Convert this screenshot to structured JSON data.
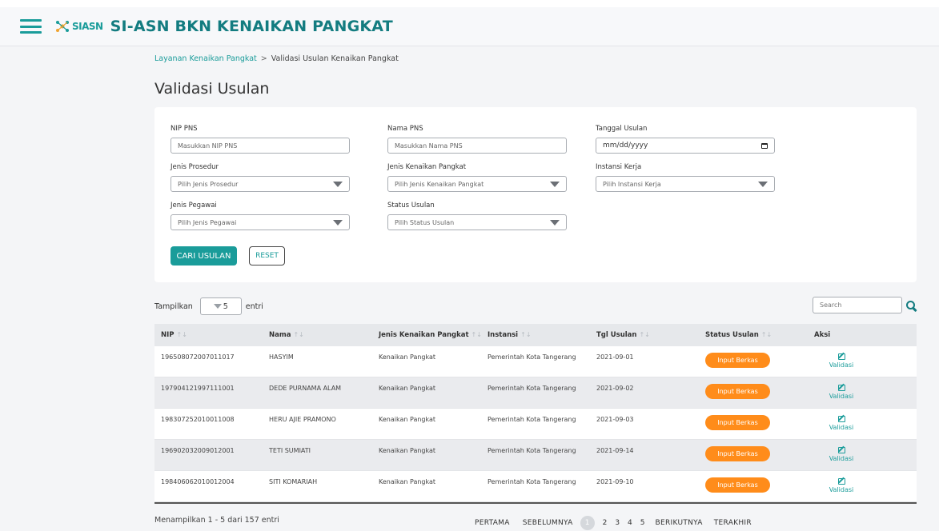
{
  "header": {
    "logo_text": "SIASN",
    "title": "SI-ASN BKN KENAIKAN PANGKAT"
  },
  "breadcrumb": {
    "parent": "Layanan Kenaikan Pangkat",
    "separator": ">",
    "current": "Validasi Usulan Kenaikan Pangkat"
  },
  "page_title": "Validasi Usulan",
  "filters": {
    "nip": {
      "label": "NIP PNS",
      "placeholder": "Masukkan NIP PNS"
    },
    "nama": {
      "label": "Nama PNS",
      "placeholder": "Masukkan Nama PNS"
    },
    "tanggal": {
      "label": "Tanggal Usulan",
      "placeholder": "mm/dd/yyyy"
    },
    "jenis_prosedur": {
      "label": "Jenis Prosedur",
      "selected": "Pilih Jenis Prosedur"
    },
    "jenis_kenaikan": {
      "label": "Jenis Kenaikan Pangkat",
      "selected": "Pilih Jenis Kenaikan Pangkat"
    },
    "instansi": {
      "label": "Instansi Kerja",
      "selected": "Pilih Instansi Kerja"
    },
    "jenis_pegawai": {
      "label": "Jenis Pegawai",
      "selected": "Pilih Jenis Pegawai"
    },
    "status": {
      "label": "Status Usulan",
      "selected": "Pilih Status Usulan"
    },
    "search_button": "CARI USULAN",
    "reset_button": "RESET"
  },
  "table_controls": {
    "show_label": "Tampilkan",
    "page_length": "5",
    "entries_label": "entri",
    "search_placeholder": "Search"
  },
  "table": {
    "columns": [
      "NIP",
      "Nama",
      "Jenis Kenaikan Pangkat",
      "Instansi",
      "Tgl Usulan",
      "Status Usulan",
      "Aksi"
    ],
    "rows": [
      {
        "nip": "196508072007011017",
        "nama": "HASYIM",
        "jenis": "Kenaikan Pangkat",
        "instansi": "Pemerintah Kota Tangerang",
        "tgl": "2021-09-01",
        "status": "Input Berkas",
        "aksi": "Validasi"
      },
      {
        "nip": "197904121997111001",
        "nama": "DEDE PURNAMA ALAM",
        "jenis": "Kenaikan Pangkat",
        "instansi": "Pemerintah Kota Tangerang",
        "tgl": "2021-09-02",
        "status": "Input Berkas",
        "aksi": "Validasi"
      },
      {
        "nip": "198307252010011008",
        "nama": "HERU AJIE PRAMONO",
        "jenis": "Kenaikan Pangkat",
        "instansi": "Pemerintah Kota Tangerang",
        "tgl": "2021-09-03",
        "status": "Input Berkas",
        "aksi": "Validasi"
      },
      {
        "nip": "196902032009012001",
        "nama": "TETI SUMIATI",
        "jenis": "Kenaikan Pangkat",
        "instansi": "Pemerintah Kota Tangerang",
        "tgl": "2021-09-14",
        "status": "Input Berkas",
        "aksi": "Validasi"
      },
      {
        "nip": "198406062010012004",
        "nama": "SITI KOMARIAH",
        "jenis": "Kenaikan Pangkat",
        "instansi": "Pemerintah Kota Tangerang",
        "tgl": "2021-09-10",
        "status": "Input Berkas",
        "aksi": "Validasi"
      }
    ]
  },
  "footer": {
    "info": "Menampilkan 1 - 5 dari 157 entri",
    "first": "PERTAMA",
    "prev": "SEBELUMNYA",
    "pages": [
      "1",
      "2",
      "3",
      "4",
      "5"
    ],
    "current_page": "1",
    "next": "BERIKUTNYA",
    "last": "TERAKHIR"
  },
  "colors": {
    "brand": "#1a9c9a",
    "title": "#137c80",
    "status_badge": "#ff8c1a"
  }
}
